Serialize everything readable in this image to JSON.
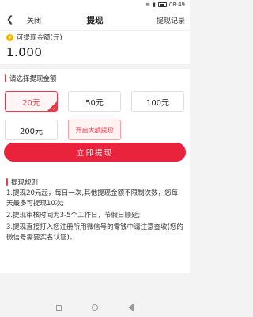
{
  "status_bar": {
    "time": "08:49"
  },
  "header": {
    "back_icon": "chevron-left-icon",
    "close_label": "关闭",
    "title": "提现",
    "record_label": "提现记录"
  },
  "balance": {
    "label": "可提现金额(元)",
    "value": "1.000"
  },
  "select": {
    "title": "请选择提现金额",
    "amounts": [
      {
        "label": "20元",
        "selected": true
      },
      {
        "label": "50元",
        "selected": false
      },
      {
        "label": "100元",
        "selected": false
      },
      {
        "label": "200元",
        "selected": false
      }
    ],
    "big_amount_label": "开启大额提现"
  },
  "submit_label": "立即提现",
  "rules": {
    "title": "提现规则",
    "lines": [
      "1.提现20元起，每日一次,其他提现金额不限制次数，您每天最多可提现10次;",
      "2.提现审核时间为3-5个工作日，节假日顺延;",
      "3.提现直接打入您注册所用微信号的零钱中请注意查收(您的微信号需要实名认证)。"
    ]
  },
  "colors": {
    "accent": "#e8233b",
    "coin": "#f5b400"
  }
}
